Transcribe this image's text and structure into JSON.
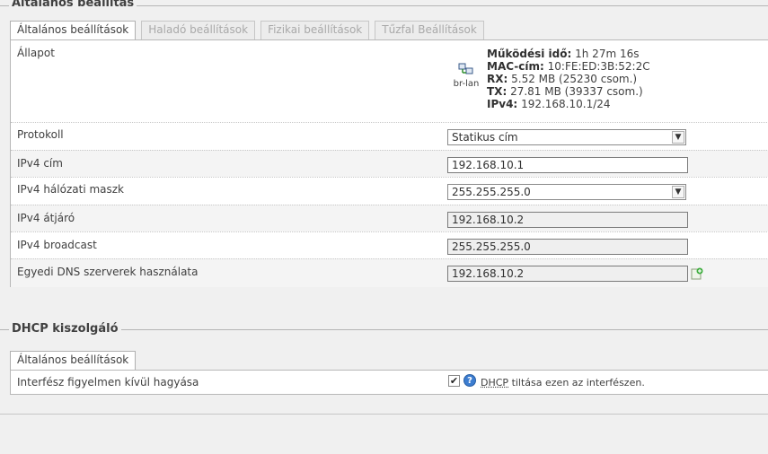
{
  "general_section": {
    "title": "Általános beállítás",
    "tabs": [
      {
        "label": "Általános beállítások",
        "active": true
      },
      {
        "label": "Haladó beállítások",
        "active": false
      },
      {
        "label": "Fizikai beállítások",
        "active": false
      },
      {
        "label": "Tűzfal Beállítások",
        "active": false
      }
    ],
    "status": {
      "label": "Állapot",
      "interface": "br-lan",
      "uptime_label": "Működési idő:",
      "uptime_value": "1h 27m 16s",
      "mac_label": "MAC-cím:",
      "mac_value": "10:FE:ED:3B:52:2C",
      "rx_label": "RX:",
      "rx_value": "5.52 MB (25230 csom.)",
      "tx_label": "TX:",
      "tx_value": "27.81 MB (39337 csom.)",
      "ipv4_label": "IPv4:",
      "ipv4_value": "192.168.10.1/24"
    },
    "protocol": {
      "label": "Protokoll",
      "value": "Statikus cím"
    },
    "ipv4_address": {
      "label": "IPv4 cím",
      "value": "192.168.10.1"
    },
    "ipv4_netmask": {
      "label": "IPv4 hálózati maszk",
      "value": "255.255.255.0"
    },
    "ipv4_gateway": {
      "label": "IPv4 átjáró",
      "value": "192.168.10.2"
    },
    "ipv4_broadcast": {
      "label": "IPv4 broadcast",
      "value": "255.255.255.0"
    },
    "custom_dns": {
      "label": "Egyedi DNS szerverek használata",
      "value": "192.168.10.2"
    }
  },
  "dhcp_section": {
    "title": "DHCP kiszolgáló",
    "tabs": [
      {
        "label": "Általános beállítások",
        "active": true
      }
    ],
    "ignore_interface": {
      "label": "Interfész figyelmen kívül hagyása",
      "checked": true,
      "desc_link": "DHCP",
      "desc_rest": "tiltása ezen az interfészen."
    }
  },
  "colors": {
    "help_icon": "#3c7dd0",
    "background": "#f0f0f0"
  }
}
